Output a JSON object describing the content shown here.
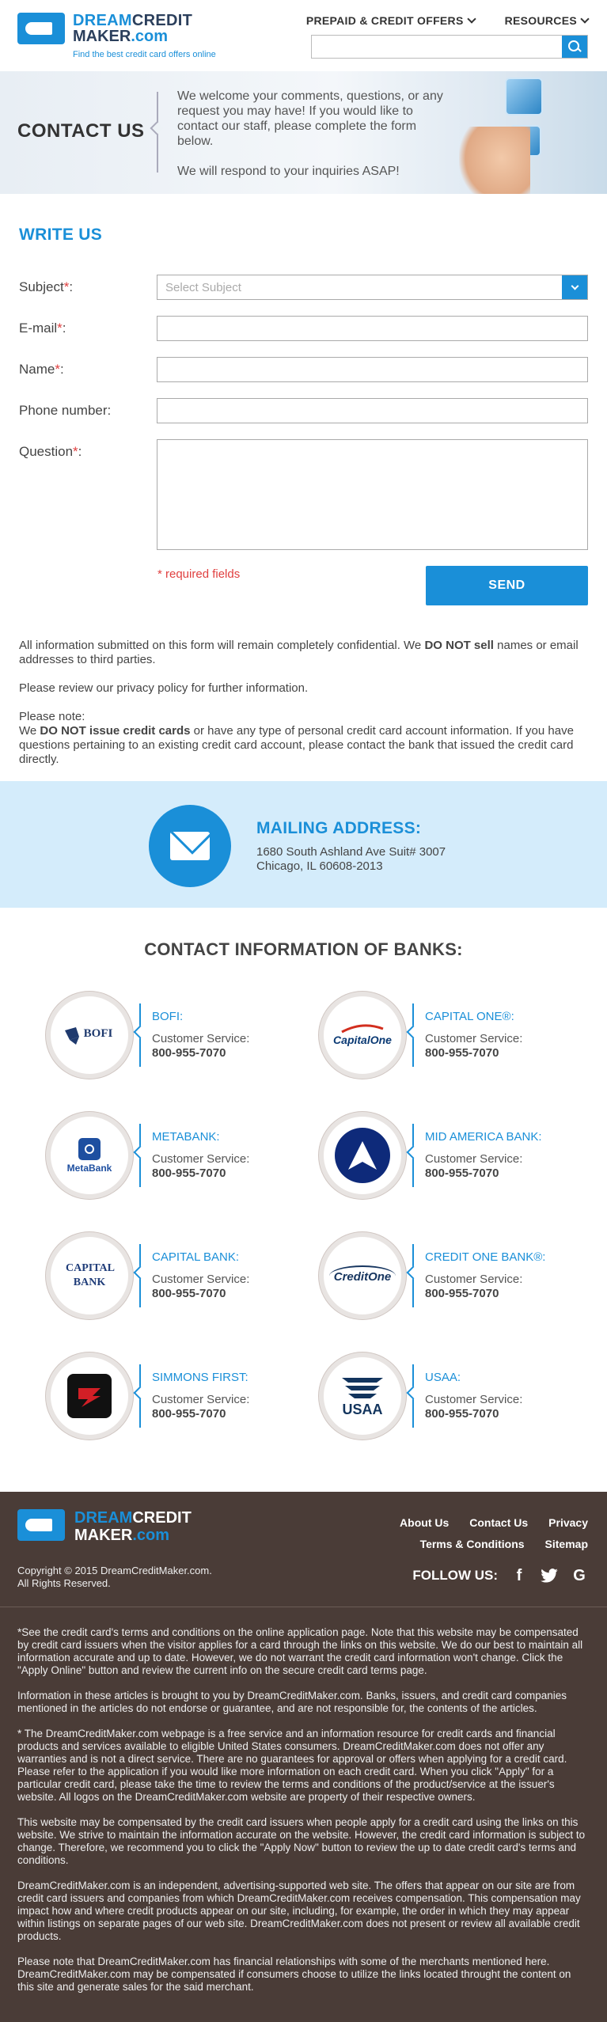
{
  "header": {
    "logo": {
      "line1_a": "DREAM",
      "line1_b": "CREDIT",
      "line2_a": "MAKER",
      "line2_b": ".com",
      "tagline": "Find the best credit card offers online"
    },
    "nav": [
      {
        "label": "PREPAID & CREDIT OFFERS"
      },
      {
        "label": "RESOURCES"
      }
    ],
    "search": {
      "placeholder": "",
      "value": ""
    }
  },
  "hero": {
    "title": "CONTACT US",
    "text1": "We welcome your comments, questions, or any request you may have! If you would like to contact our staff, please complete the form below.",
    "text2": "We will respond to your inquiries ASAP!"
  },
  "write": {
    "title": "WRITE US",
    "subject_label": "Subject",
    "subject_placeholder": "Select Subject",
    "email_label": "E-mail",
    "name_label": "Name",
    "phone_label": "Phone number",
    "question_label": "Question",
    "req_mark": "*",
    "colon": ":",
    "required_note": "* required fields",
    "send_label": "SEND"
  },
  "notes": {
    "p1a": "All information submitted on this form will remain completely confidential. We ",
    "p1b": "DO NOT sell",
    "p1c": " names or email addresses to third parties.",
    "p2": "Please review our privacy policy for further information.",
    "p3a": "Please note:",
    "p3b": "We ",
    "p3c": "DO NOT issue credit cards",
    "p3d": " or have any type of personal credit card account information. If you have questions pertaining to an existing credit card account, please contact the bank that issued the credit card directly."
  },
  "mailing": {
    "title": "MAILING ADDRESS:",
    "line1": "1680 South Ashland Ave Suit# 3007",
    "line2": "Chicago, IL 60608-2013"
  },
  "banks_title": "CONTACT INFORMATION OF BANKS:",
  "banks": [
    {
      "name": "BOFI:",
      "cs": "Customer Service:",
      "phone": "800-955-7070",
      "logo": "BOFI",
      "color": "#1f3a6e"
    },
    {
      "name": "CAPITAL ONE®:",
      "cs": "Customer Service:",
      "phone": "800-955-7070",
      "logo": "CapitalOne",
      "color": "#0b3a74"
    },
    {
      "name": "METABANK:",
      "cs": "Customer Service:",
      "phone": "800-955-7070",
      "logo": "MetaBank",
      "color": "#1e4fa0"
    },
    {
      "name": "MID AMERICA BANK:",
      "cs": "Customer Service:",
      "phone": "800-955-7070",
      "logo": "",
      "color": "#0e2a7a"
    },
    {
      "name": "CAPITAL BANK:",
      "cs": "Customer Service:",
      "phone": "800-955-7070",
      "logo": "CAPITAL BANK",
      "color": "#213e7a"
    },
    {
      "name": "CREDIT ONE BANK®:",
      "cs": "Customer Service:",
      "phone": "800-955-7070",
      "logo": "CreditOne",
      "color": "#16355f"
    },
    {
      "name": "SIMMONS FIRST:",
      "cs": "Customer Service:",
      "phone": "800-955-7070",
      "logo": "",
      "color": "#d21f26"
    },
    {
      "name": "USAA:",
      "cs": "Customer Service:",
      "phone": "800-955-7070",
      "logo": "USAA",
      "color": "#12345d"
    }
  ],
  "footer": {
    "logo_a": "DREAM",
    "logo_b": "CREDIT",
    "logo_c": "MAKER",
    "logo_d": ".com",
    "copyright": "Copyright © 2015 DreamCreditMaker.com.",
    "rights": "All Rights Reserved.",
    "links": [
      "About Us",
      "Contact Us",
      "Privacy",
      "Terms & Conditions",
      "Sitemap"
    ],
    "follow": "FOLLOW US:",
    "social": [
      {
        "icon": "facebook-icon",
        "glyph": "f"
      },
      {
        "icon": "twitter-icon",
        "glyph": "t"
      },
      {
        "icon": "google-icon",
        "glyph": "G"
      }
    ],
    "disclaimers": [
      "*See the credit card's terms and conditions on the online application page. Note that this website may be compensated by credit card issuers when the visitor applies for a card through the links on this website. We do our best to maintain all information accurate and up to date. However, we do not warrant the credit card information won't change. Click the \"Apply Online\" button and review the current info on the secure credit card terms page.",
      "Information in these articles is brought to you by DreamCreditMaker.com. Banks, issuers, and credit card companies mentioned in the articles do not endorse or guarantee, and are not responsible for, the contents of the articles.",
      "* The DreamCreditMaker.com webpage is a free service and an information resource for credit cards and financial products and services available to eligible United States consumers. DreamCreditMaker.com does not offer any warranties and is not a direct service. There are no guarantees for approval or offers when applying for a credit card. Please refer to the application if you would like more information on each credit card. When you click \"Apply\" for a particular credit card, please take the time to review the terms and conditions of the product/service at the issuer's website. All logos on the DreamCreditMaker.com website are property of their respective owners.",
      "This website may be compensated by the credit card issuers when people apply for a credit card using the links on this website. We strive to maintain the information accurate on the website. However, the credit card information is subject to change. Therefore, we recommend you to click the \"Apply Now\" button to review the up to date credit card's terms and conditions.",
      "DreamCreditMaker.com is an independent, advertising-supported web site. The offers that appear on our site are from credit card issuers and companies from which DreamCreditMaker.com receives compensation. This compensation may impact how and where credit products appear on our site, including, for example, the order in which they may appear within listings on separate pages of our web site. DreamCreditMaker.com does not present or review all available credit products.",
      "Please note that DreamCreditMaker.com has financial relationships with some of the merchants mentioned here. DreamCreditMaker.com may be compensated if consumers choose to utilize the links located throught the content on this site and generate sales for the said merchant."
    ]
  }
}
